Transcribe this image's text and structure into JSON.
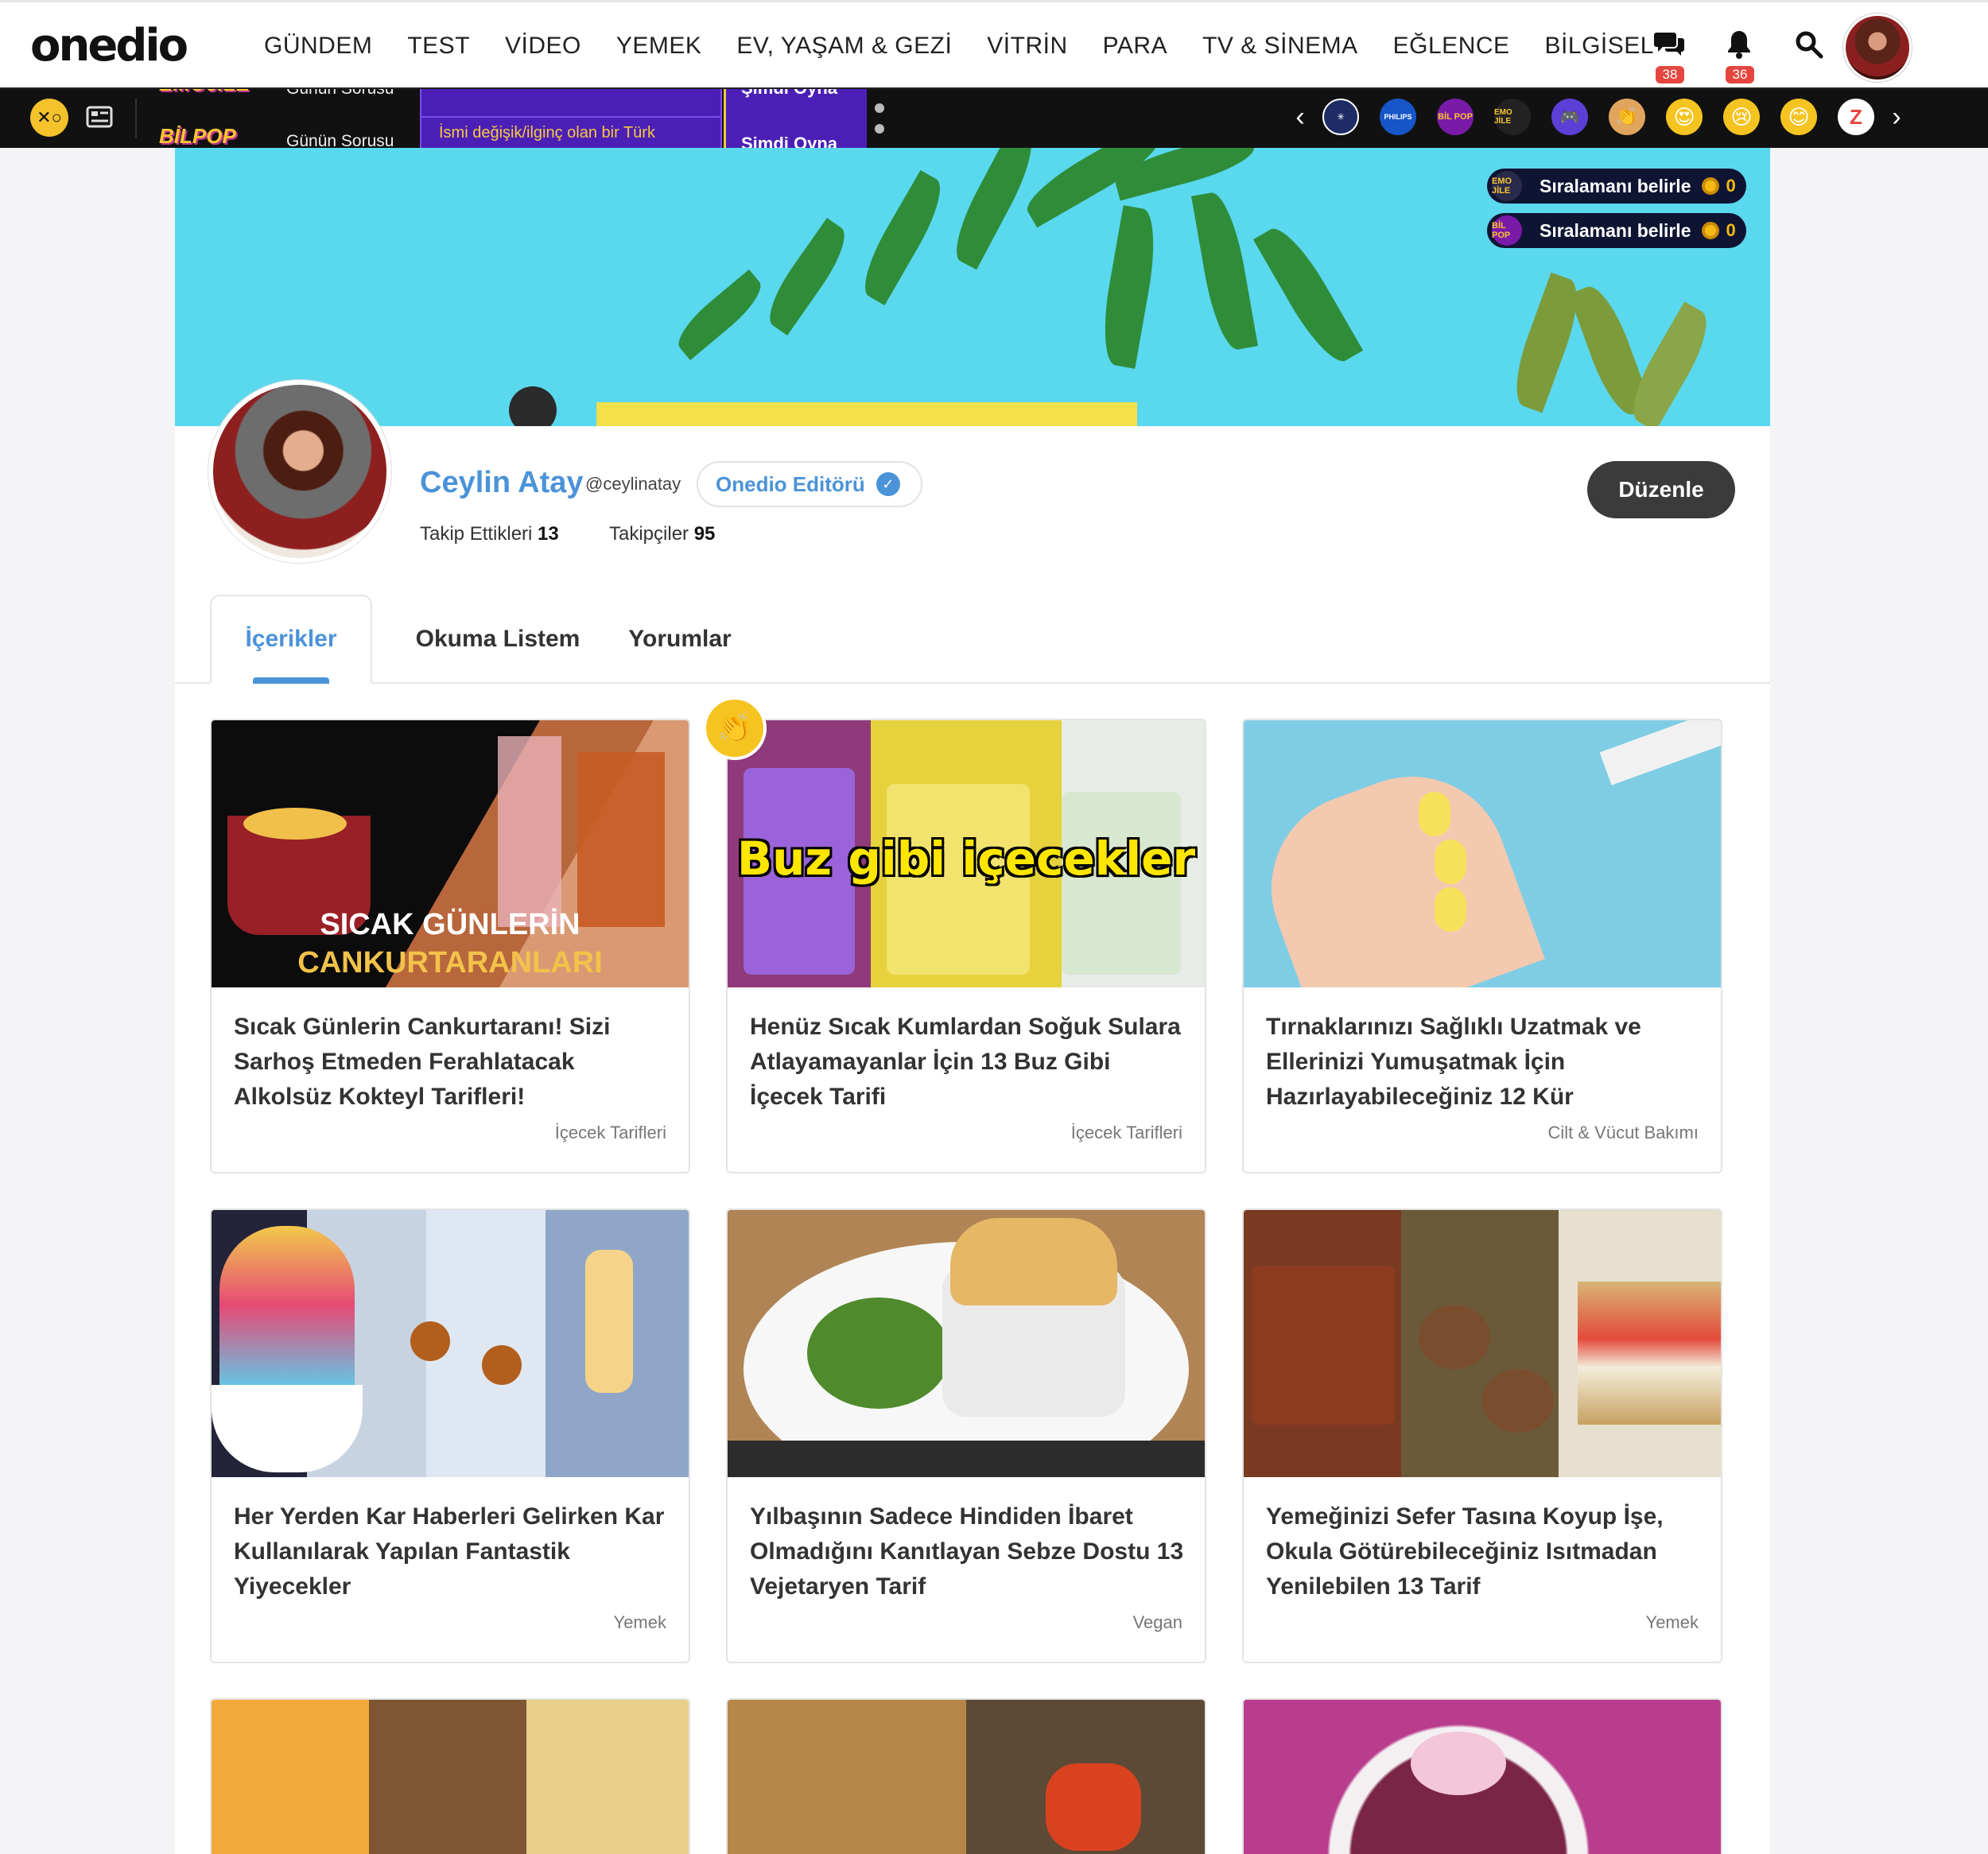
{
  "nav": {
    "logo": "onedio",
    "menu": [
      "GÜNDEM",
      "TEST",
      "VİDEO",
      "YEMEK",
      "EV, YAŞAM & GEZİ",
      "VİTRİN",
      "PARA",
      "TV & SİNEMA",
      "EĞLENCE",
      "BİLGİSEL"
    ],
    "messages_count": "38",
    "notifications_count": "36",
    "icons": {
      "messages": "chat-bubbles-icon",
      "notifications": "bell-icon",
      "search": "search-icon"
    }
  },
  "strip": {
    "ticker_logo_top": "EMOJİLE",
    "ticker_label_top": "Günün Sorusu",
    "ticker_logo": "BİLPOP",
    "ticker_label": "Günün Sorusu",
    "ticker_question": "İsmi değişik/ilginç olan bir Türk",
    "ticker_play_top": "Şimdi Oyna",
    "ticker_play": "Şimdi Oyna",
    "carousel_items": [
      "UK",
      "PHILIPS",
      "BİL POP",
      "EMO JİLE",
      "gamepad",
      "clap",
      "heart-eyes",
      "sad",
      "smile",
      "Z"
    ]
  },
  "cover": {
    "rank_items": [
      {
        "logo": "EMO JİLE",
        "label": "Sıralamanı belirle",
        "points": "0"
      },
      {
        "logo": "BİL POP",
        "label": "Sıralamanı belirle",
        "points": "0"
      }
    ]
  },
  "profile": {
    "name": "Ceylin Atay",
    "handle": "@ceylinatay",
    "badge": "Onedio Editörü",
    "following_label": "Takip Ettikleri",
    "following_count": "13",
    "followers_label": "Takipçiler",
    "followers_count": "95",
    "edit_label": "Düzenle"
  },
  "tabs": [
    "İçerikler",
    "Okuma Listem",
    "Yorumlar"
  ],
  "cards": [
    {
      "title": "Sıcak Günlerin Cankurtaranı! Sizi Sarhoş Etmeden Ferahlatacak Alkolsüz Kokteyl Tarifleri!",
      "category": "İçecek Tarifleri",
      "overlay1": "SICAK GÜNLERİN",
      "overlay2": "CANKURTARANLARI"
    },
    {
      "title": "Henüz Sıcak Kumlardan Soğuk Sulara Atlayamayanlar İçin 13 Buz Gibi İçecek Tarifi",
      "category": "İçecek Tarifleri",
      "overlay1": "Buz gibi içecekler"
    },
    {
      "title": "Tırnaklarınızı Sağlıklı Uzatmak ve Ellerinizi Yumuşatmak İçin Hazırlayabileceğiniz 12 Kür",
      "category": "Cilt & Vücut Bakımı"
    },
    {
      "title": "Her Yerden Kar Haberleri Gelirken Kar Kullanılarak Yapılan Fantastik Yiyecekler",
      "category": "Yemek"
    },
    {
      "title": "Yılbaşının Sadece Hindiden İbaret Olmadığını Kanıtlayan Sebze Dostu 13 Vejetaryen Tarif",
      "category": "Vegan"
    },
    {
      "title": "Yemeğinizi Sefer Tasına Koyup İşe, Okula Götürebileceğiniz Isıtmadan Yenilebilen 13 Tarif",
      "category": "Yemek"
    }
  ]
}
